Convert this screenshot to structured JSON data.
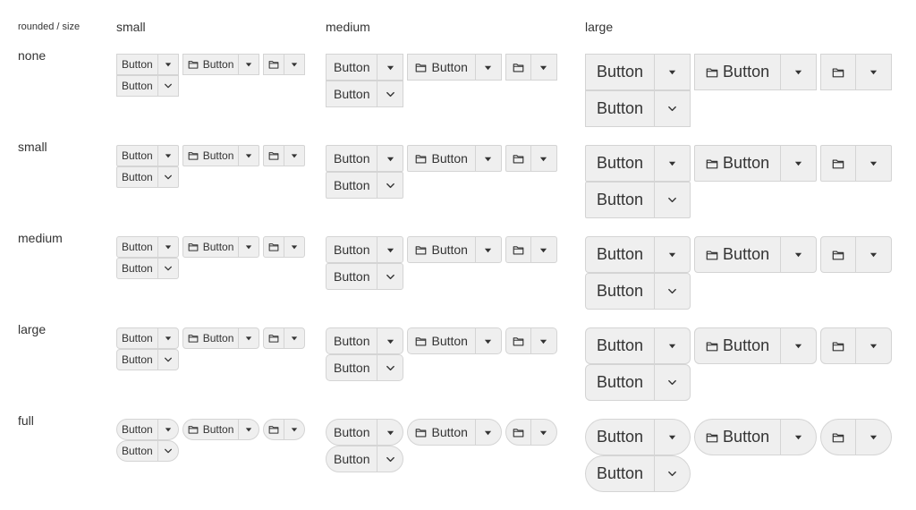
{
  "header": {
    "corner": "rounded / size",
    "sizes": [
      "small",
      "medium",
      "large"
    ]
  },
  "rows": [
    "none",
    "small",
    "medium",
    "large",
    "full"
  ],
  "button": {
    "label": "Button",
    "icon": "folder-icon",
    "trigger_icon_primary": "caret-down-icon",
    "trigger_icon_secondary": "chevron-down-icon"
  },
  "radius_map": {
    "none": {
      "small": 0,
      "medium": 0,
      "large": 0
    },
    "small": {
      "small": 2,
      "medium": 2,
      "large": 2
    },
    "medium": {
      "small": 3,
      "medium": 3,
      "large": 4
    },
    "large": {
      "small": 4,
      "medium": 5,
      "large": 6
    },
    "full": {
      "small": 999,
      "medium": 999,
      "large": 999
    }
  },
  "colors": {
    "button_bg": "#efefef",
    "button_border": "#d4d4d4",
    "text": "#333333"
  }
}
